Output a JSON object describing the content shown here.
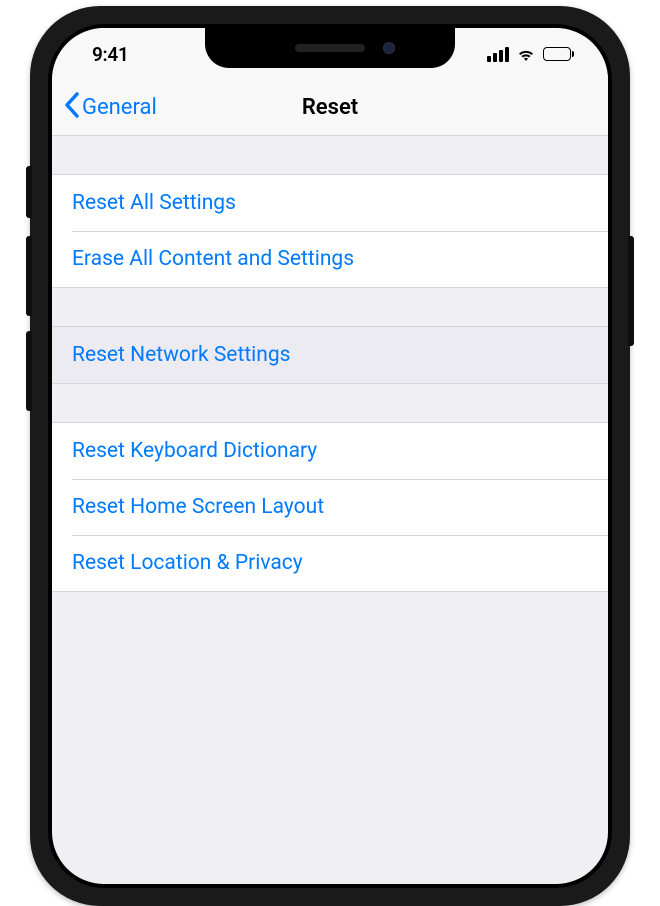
{
  "status": {
    "time": "9:41"
  },
  "nav": {
    "back_label": "General",
    "title": "Reset"
  },
  "groups": [
    {
      "items": [
        {
          "label": "Reset All Settings"
        },
        {
          "label": "Erase All Content and Settings"
        }
      ]
    },
    {
      "items": [
        {
          "label": "Reset Network Settings"
        }
      ]
    },
    {
      "items": [
        {
          "label": "Reset Keyboard Dictionary"
        },
        {
          "label": "Reset Home Screen Layout"
        },
        {
          "label": "Reset Location & Privacy"
        }
      ]
    }
  ]
}
